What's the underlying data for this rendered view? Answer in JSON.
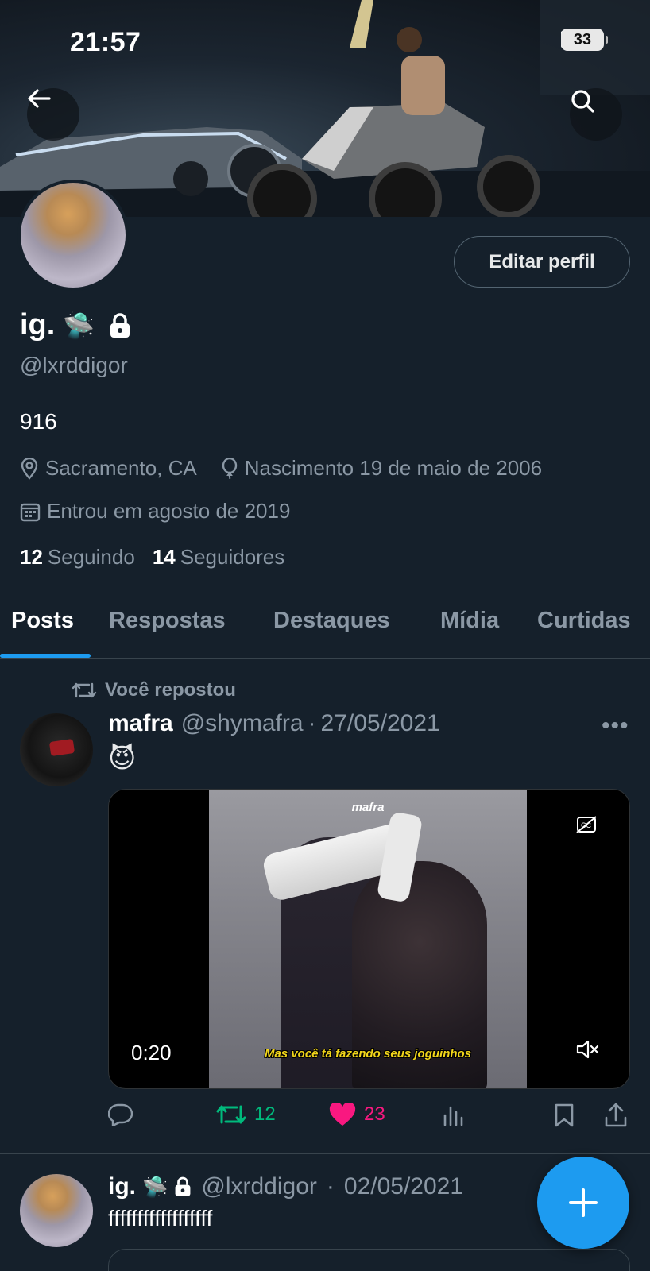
{
  "status_bar": {
    "time": "21:57",
    "battery": "33"
  },
  "profile": {
    "edit_button": "Editar perfil",
    "display_name": "ig.",
    "name_emoji": "🛸",
    "handle": "@lxrddigor",
    "bio": "916",
    "location": "Sacramento, CA",
    "birth": "Nascimento 19 de maio de 2006",
    "joined": "Entrou em agosto de 2019",
    "following_count": "12",
    "following_label": "Seguindo",
    "followers_count": "14",
    "followers_label": "Seguidores"
  },
  "tabs": [
    {
      "label": "Posts",
      "active": true
    },
    {
      "label": "Respostas"
    },
    {
      "label": "Destaques"
    },
    {
      "label": "Mídia"
    },
    {
      "label": "Curtidas"
    }
  ],
  "posts": [
    {
      "repost_label": "Você repostou",
      "author_name": "mafra",
      "author_handle": "@shymafra",
      "separator": "·",
      "date": "27/05/2021",
      "text": "😈",
      "video": {
        "watermark": "mafra",
        "subtitle": "Mas você tá fazendo seus joguinhos",
        "duration": "0:20"
      },
      "retweets": "12",
      "likes": "23",
      "colors": {
        "retweet": "#00ba7c",
        "like": "#f91880"
      }
    },
    {
      "author_name": "ig.",
      "author_emoji": "🛸",
      "author_handle": "@lxrddigor",
      "separator": "·",
      "date": "02/05/2021",
      "text": "ffffffffffffffffff"
    }
  ],
  "icons": {
    "back": "arrow-left-icon",
    "search": "search-icon",
    "lock": "lock-icon",
    "location": "location-pin-icon",
    "birth": "balloon-icon",
    "calendar": "calendar-icon",
    "repost": "repost-icon",
    "reply": "reply-icon",
    "like": "heart-icon",
    "views": "views-icon",
    "bookmark": "bookmark-icon",
    "share": "share-icon",
    "compose": "plus-icon"
  },
  "accent_color": "#1d9bf0"
}
